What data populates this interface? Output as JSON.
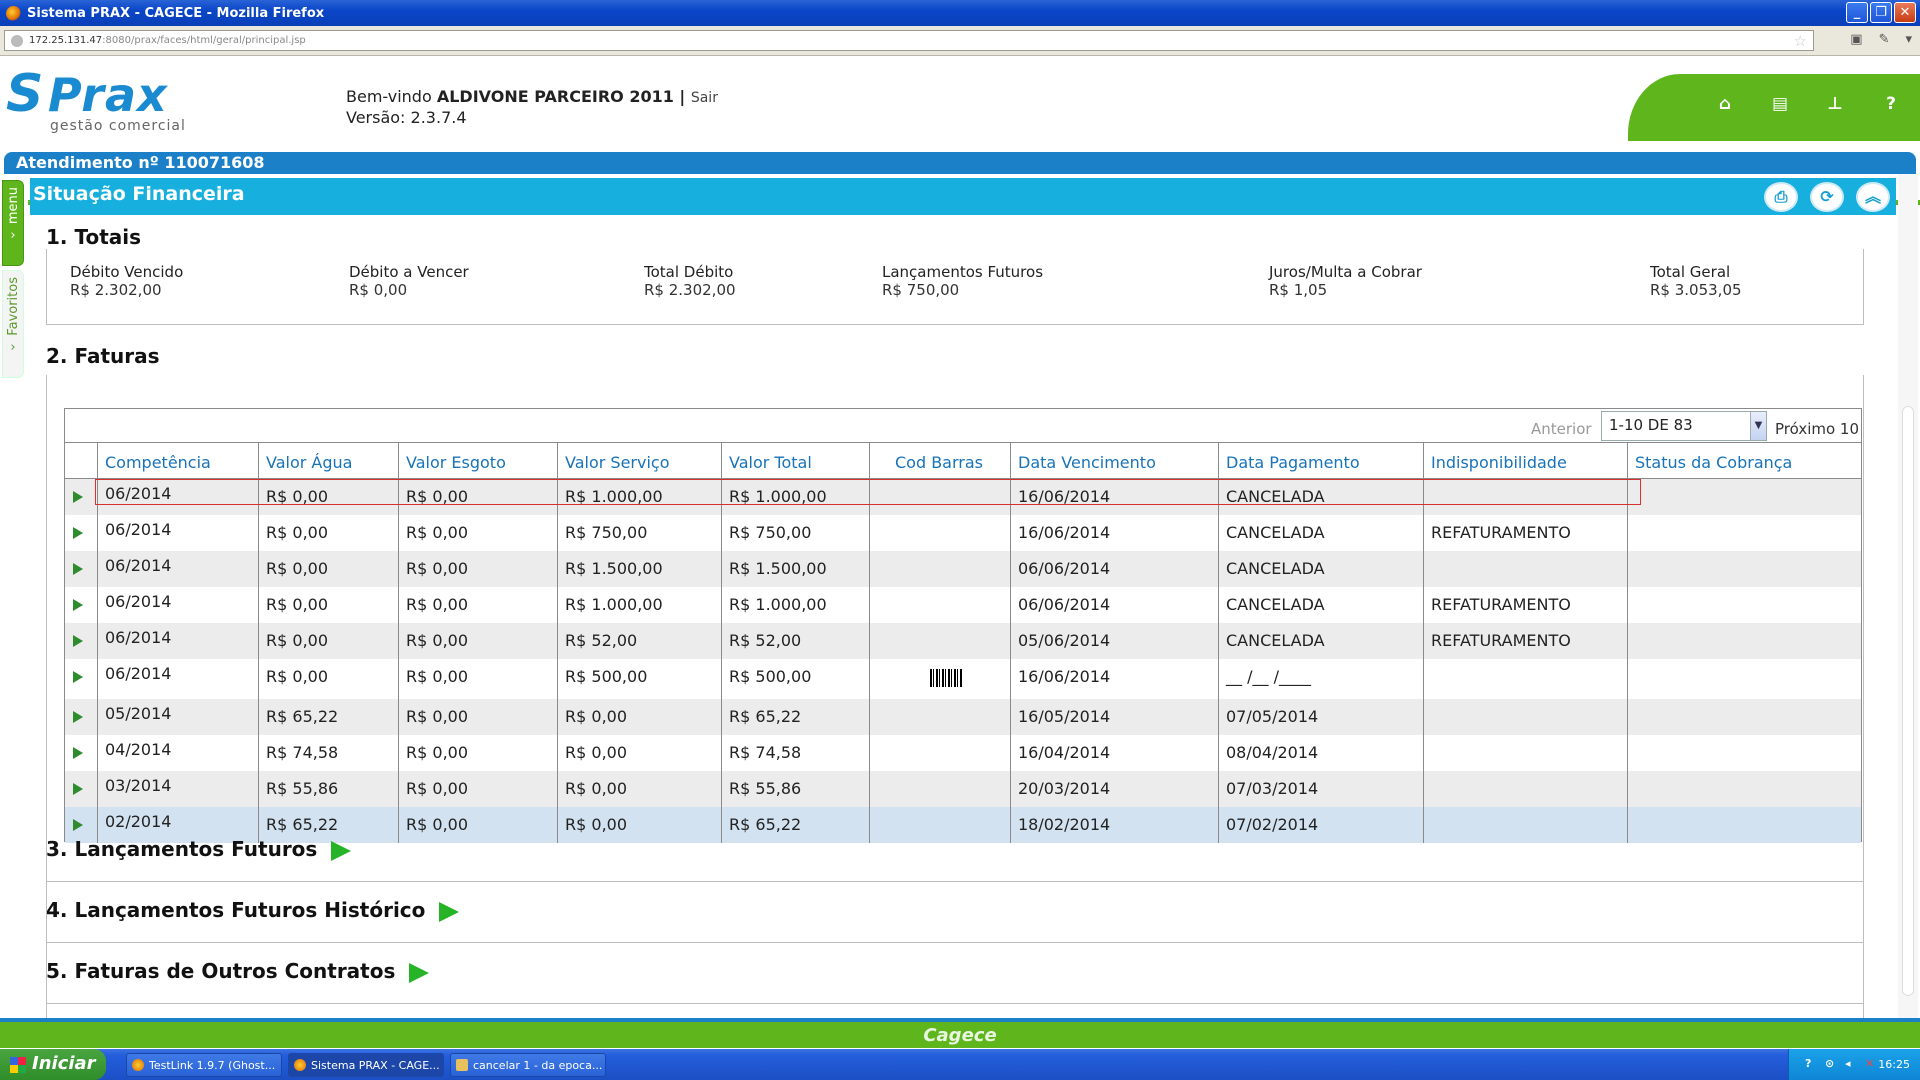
{
  "window": {
    "title": "Sistema PRAX - CAGECE - Mozilla Firefox"
  },
  "browser": {
    "url_host": "172.25.131.47",
    "url_rest": ":8080/prax/faces/html/geral/principal.jsp"
  },
  "header": {
    "logo_name": "Prax",
    "logo_sub": "gestão comercial",
    "welcome_prefix": "Bem-vindo ",
    "user": "ALDIVONE PARCEIRO 2011",
    "sep": " | ",
    "logout": "Sair",
    "version": "Versão: 2.3.7.4",
    "nav_icons": [
      "home-icon",
      "print-icon",
      "sitemap-icon",
      "help-icon"
    ]
  },
  "atendimento": "Atendimento nº 110071608",
  "sidebar": {
    "menu": "menu",
    "favoritos": "Favoritos"
  },
  "page": {
    "title": "Situação Financeira"
  },
  "totais": {
    "heading": "1. Totais",
    "items": [
      {
        "label": "Débito Vencido",
        "value": "R$ 2.302,00"
      },
      {
        "label": "Débito a Vencer",
        "value": "R$ 0,00"
      },
      {
        "label": "Total Débito",
        "value": "R$ 2.302,00"
      },
      {
        "label": "Lançamentos Futuros",
        "value": "R$ 750,00"
      },
      {
        "label": "Juros/Multa a Cobrar",
        "value": "R$ 1,05"
      },
      {
        "label": "Total Geral",
        "value": "R$ 3.053,05"
      }
    ]
  },
  "faturas": {
    "heading": "2. Faturas",
    "pager": {
      "previous": "Anterior",
      "selected": "1-10 DE 83",
      "next": "Próximo 10"
    },
    "columns": [
      "Competência",
      "Valor Água",
      "Valor Esgoto",
      "Valor Serviço",
      "Valor Total",
      "Cod Barras",
      "Data Vencimento",
      "Data Pagamento",
      "Indisponibilidade",
      "Status da Cobrança"
    ],
    "rows": [
      [
        "06/2014",
        "R$ 0,00",
        "R$ 0,00",
        "R$ 1.000,00",
        "R$ 1.000,00",
        "",
        "16/06/2014",
        "CANCELADA",
        "",
        ""
      ],
      [
        "06/2014",
        "R$ 0,00",
        "R$ 0,00",
        "R$ 750,00",
        "R$ 750,00",
        "",
        "16/06/2014",
        "CANCELADA",
        "REFATURAMENTO",
        ""
      ],
      [
        "06/2014",
        "R$ 0,00",
        "R$ 0,00",
        "R$ 1.500,00",
        "R$ 1.500,00",
        "",
        "06/06/2014",
        "CANCELADA",
        "",
        ""
      ],
      [
        "06/2014",
        "R$ 0,00",
        "R$ 0,00",
        "R$ 1.000,00",
        "R$ 1.000,00",
        "",
        "06/06/2014",
        "CANCELADA",
        "REFATURAMENTO",
        ""
      ],
      [
        "06/2014",
        "R$ 0,00",
        "R$ 0,00",
        "R$ 52,00",
        "R$ 52,00",
        "",
        "05/06/2014",
        "CANCELADA",
        "REFATURAMENTO",
        ""
      ],
      [
        "06/2014",
        "R$ 0,00",
        "R$ 0,00",
        "R$ 500,00",
        "R$ 500,00",
        "barcode",
        "16/06/2014",
        "__ /__ /____",
        "",
        ""
      ],
      [
        "05/2014",
        "R$ 65,22",
        "R$ 0,00",
        "R$ 0,00",
        "R$ 65,22",
        "",
        "16/05/2014",
        "07/05/2014",
        "",
        ""
      ],
      [
        "04/2014",
        "R$ 74,58",
        "R$ 0,00",
        "R$ 0,00",
        "R$ 74,58",
        "",
        "16/04/2014",
        "08/04/2014",
        "",
        ""
      ],
      [
        "03/2014",
        "R$ 55,86",
        "R$ 0,00",
        "R$ 0,00",
        "R$ 55,86",
        "",
        "20/03/2014",
        "07/03/2014",
        "",
        ""
      ],
      [
        "02/2014",
        "R$ 65,22",
        "R$ 0,00",
        "R$ 0,00",
        "R$ 65,22",
        "",
        "18/02/2014",
        "07/02/2014",
        "",
        ""
      ]
    ]
  },
  "sections": [
    {
      "heading": "3. Lançamentos Futuros"
    },
    {
      "heading": "4. Lançamentos Futuros Histórico"
    },
    {
      "heading": "5. Faturas de Outros Contratos"
    }
  ],
  "footer": {
    "brand": "Cagece"
  },
  "taskbar": {
    "start": "Iniciar",
    "tasks": [
      "TestLink 1.9.7 (Ghost...",
      "Sistema PRAX - CAGE...",
      "cancelar 1 - da epoca..."
    ],
    "clock": "16:25"
  },
  "colors": {
    "brand_green": "#5fb61c",
    "brand_blue": "#1c80c8",
    "section_cyan": "#17b0de",
    "selected_row": "#d3e2f0",
    "header_text": "#1873b8"
  }
}
